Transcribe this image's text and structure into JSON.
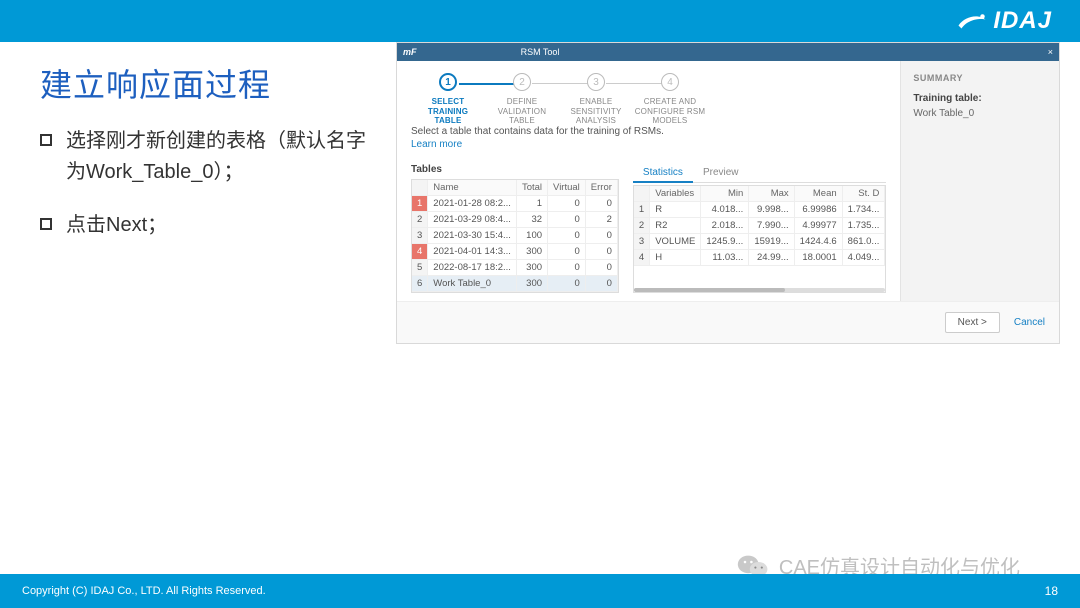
{
  "brand": "IDAJ",
  "slide": {
    "title": "建立响应面过程",
    "bullets": [
      "选择刚才新创建的表格（默认名字为Work_Table_0）；",
      "点击Next；"
    ],
    "copyright": "Copyright (C)  IDAJ Co., LTD. All Rights Reserved.",
    "page_number": "18"
  },
  "watermark": "CAE仿真设计自动化与优化",
  "app": {
    "mf": "mF",
    "window_title": "RSM Tool",
    "close_glyph": "×",
    "stepper": [
      {
        "num": "1",
        "label": "SELECT\nTRAINING\nTABLE",
        "active": true
      },
      {
        "num": "2",
        "label": "DEFINE\nVALIDATION\nTABLE",
        "active": false
      },
      {
        "num": "3",
        "label": "ENABLE\nSENSITIVITY\nANALYSIS",
        "active": false
      },
      {
        "num": "4",
        "label": "CREATE AND\nCONFIGURE RSM\nMODELS",
        "active": false
      }
    ],
    "instruction": "Select a table that contains data for the training of RSMs.",
    "learn_more": "Learn more",
    "tables_label": "Tables",
    "tables": {
      "headers": {
        "name": "Name",
        "total": "Total",
        "virtual": "Virtual",
        "error": "Error"
      },
      "rows": [
        {
          "idx": "1",
          "name": "2021-01-28 08:2...",
          "total": "1",
          "virtual": "0",
          "error": "0",
          "hl": true
        },
        {
          "idx": "2",
          "name": "2021-03-29 08:4...",
          "total": "32",
          "virtual": "0",
          "error": "2",
          "hl": false
        },
        {
          "idx": "3",
          "name": "2021-03-30 15:4...",
          "total": "100",
          "virtual": "0",
          "error": "0",
          "hl": false
        },
        {
          "idx": "4",
          "name": "2021-04-01 14:3...",
          "total": "300",
          "virtual": "0",
          "error": "0",
          "hl": true
        },
        {
          "idx": "5",
          "name": "2022-08-17 18:2...",
          "total": "300",
          "virtual": "0",
          "error": "0",
          "hl": false
        },
        {
          "idx": "6",
          "name": "Work Table_0",
          "total": "300",
          "virtual": "0",
          "error": "0",
          "hl": false,
          "selected": true
        }
      ]
    },
    "stats_tabs": {
      "statistics": "Statistics",
      "preview": "Preview"
    },
    "stats": {
      "headers": {
        "variables": "Variables",
        "min": "Min",
        "max": "Max",
        "mean": "Mean",
        "std": "St. D"
      },
      "rows": [
        {
          "idx": "1",
          "var": "R",
          "min": "4.018...",
          "max": "9.998...",
          "mean": "6.99986",
          "std": "1.734..."
        },
        {
          "idx": "2",
          "var": "R2",
          "min": "2.018...",
          "max": "7.990...",
          "mean": "4.99977",
          "std": "1.735..."
        },
        {
          "idx": "3",
          "var": "VOLUME",
          "min": "1245.9...",
          "max": "15919...",
          "mean": "1424.4.6",
          "std": "861.0..."
        },
        {
          "idx": "4",
          "var": "H",
          "min": "11.03...",
          "max": "24.99...",
          "mean": "18.0001",
          "std": "4.049..."
        }
      ]
    },
    "buttons": {
      "next": "Next  >",
      "cancel": "Cancel"
    },
    "summary": {
      "header": "SUMMARY",
      "training_label": "Training table:",
      "training_value": "Work Table_0"
    }
  }
}
